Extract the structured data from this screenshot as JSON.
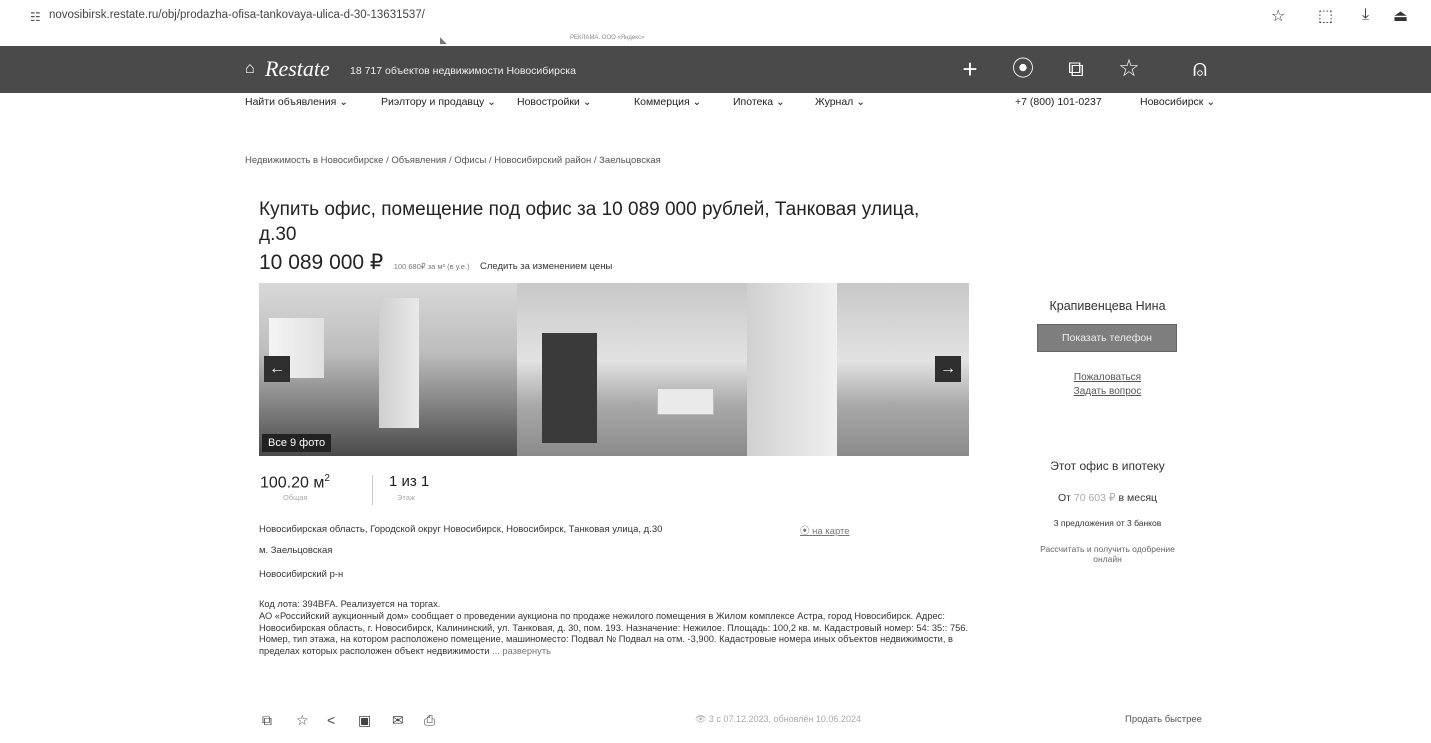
{
  "browser": {
    "url": "novosibirsk.restate.ru/obj/prodazha-ofisa-tankovaya-ulica-d-30-13631537/"
  },
  "promo": {
    "left": "",
    "mid": "РЕКЛАМА. ООО «Яндекс»",
    "right": ""
  },
  "header": {
    "brand": "Restate",
    "tagline": "18 717 объектов недвижимости Новосибирска"
  },
  "nav": {
    "items": [
      "Найти объявления ⌄",
      "Риэлтору и продавцу ⌄",
      "Новостройки ⌄",
      "Коммерция ⌄",
      "Ипотека ⌄",
      "Журнал ⌄"
    ],
    "phone": "+7 (800) 101-0237",
    "city": "Новосибирск ⌄"
  },
  "breadcrumb": "Недвижимость в Новосибирске / Объявления / Офисы / Новосибирский район / Заельцовская",
  "listing": {
    "title": "Купить офис, помещение под офис за 10 089 000 рублей, Танковая улица, д.30",
    "price": "10 089 000 ₽",
    "price_per_m2": "100 680₽ за м² (в у.е.)",
    "follow_price": "Следить за изменением цены",
    "all_photos": "Все 9 фото",
    "area_value": "100.20 м",
    "area_sup": "2",
    "area_label": "Общая",
    "floor_value": "1 из 1",
    "floor_label": "Этаж",
    "address": "Новосибирская область, Городской округ Новосибирск, Новосибирск, Танковая улица, д.30",
    "map_link": "⦿ на карте",
    "metro": "м. Заельцовская",
    "district": "Новосибирский р-н",
    "description": "Код лота: 394BFA. Реализуется на торгах.\nАО «Российский аукционный дом» сообщает о проведении аукциона по продаже нежилого помещения в Жилом комплексе Астра, город Новосибирск. Адрес: Новосибирская область, г. Новосибирск, Калининский, ул. Танковая, д. 30, пом. 193. Назначение: Нежилое. Площадь: 100,2 кв. м. Кадастровый номер: 54: 35:: 756. Номер, тип этажа, на котором расположено помещение, машиноместо: Подвал № Подвал на отм. -3,900. Кадастровые номера иных объектов недвижимости, в пределах которых расположен объект недвижимости",
    "expand": "... развернуть"
  },
  "footer": {
    "views": "👁 3 с 07.12.2023, обновлён 10.06.2024",
    "sell_fast": "Продать быстрее"
  },
  "agent": {
    "name": "Крапивенцева Нина",
    "show_phone": "Показать телефон",
    "complain": "Пожаловаться",
    "ask": "Задать вопрос"
  },
  "mortgage": {
    "title": "Этот офис в ипотеку",
    "prefix": "От",
    "amount": "70 603 ₽",
    "suffix": "в месяц",
    "offers": "3 предложения от 3 банков",
    "calc": "Рассчитать и получить одобрение онлайн"
  },
  "icons": {
    "add": "plus-icon",
    "location": "pin-icon",
    "compare": "copy-icon",
    "favorite": "star-icon",
    "profile": "user-icon"
  },
  "colors": {
    "header_bg": "#4a4a4a",
    "button_bg": "#7e7e7e"
  }
}
